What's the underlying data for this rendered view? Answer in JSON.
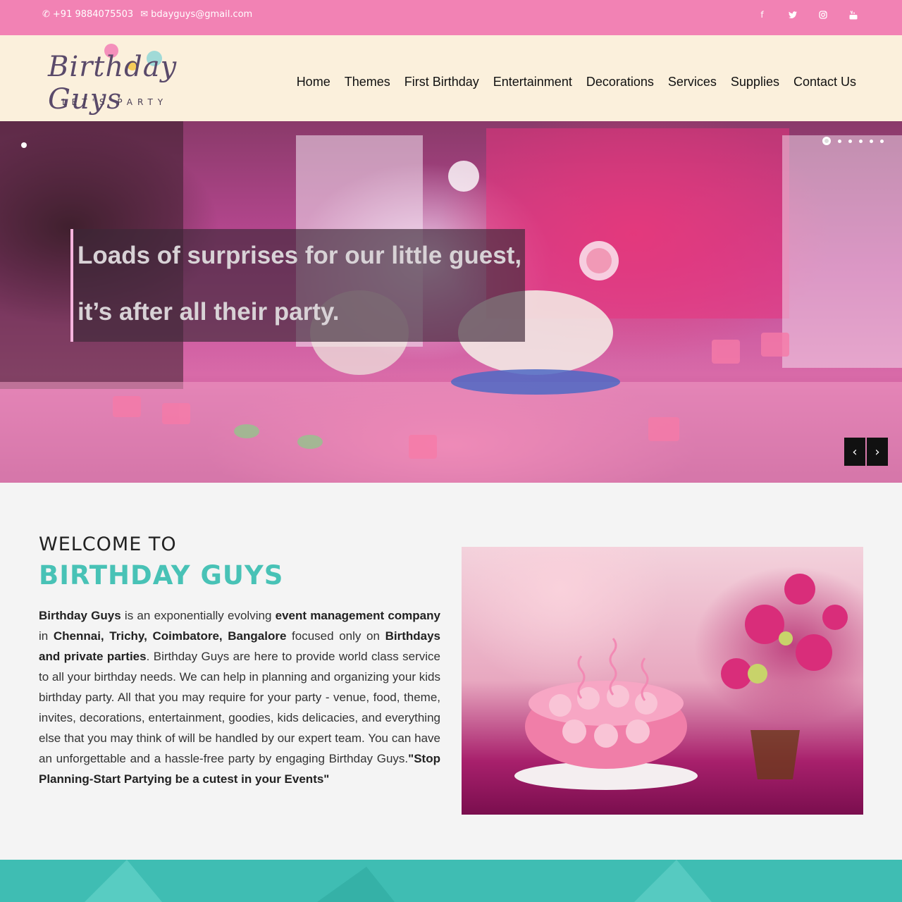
{
  "topbar": {
    "phone": "+91 9884075503",
    "email": "bdayguys@gmail.com",
    "social": [
      "facebook-icon",
      "twitter-icon",
      "instagram-icon",
      "youtube-icon"
    ]
  },
  "logo": {
    "name": "Birthday Guys",
    "tagline": "LET'S PARTY"
  },
  "nav": [
    "Home",
    "Themes",
    "First Birthday",
    "Entertainment",
    "Decorations",
    "Services",
    "Supplies",
    "Contact Us"
  ],
  "hero": {
    "caption_line1": "Loads of surprises for our little guest,",
    "caption_line2": "it’s after all their party.",
    "slides": 6,
    "active_slide": 1,
    "prev_icon": "chevron-left-icon",
    "next_icon": "chevron-right-icon"
  },
  "welcome": {
    "title_small": "WELCOME TO",
    "title_big": "BIRTHDAY GUYS",
    "p1_b1": "Birthday Guys",
    "p1_t1": " is an exponentially evolving ",
    "p1_b2": "event management company",
    "p1_t2": " in ",
    "p1_b3": "Chennai, Trichy, Coimbatore, Bangalore",
    "p1_t3": " focused only on ",
    "p1_b4": "Birthdays and private parties",
    "p1_t4": ". Birthday Guys are here to provide world class service to all your birthday needs. We can help in planning and organizing your kids birthday party. All that you may require for your party - venue, food, theme, invites, decorations, entertainment, goodies, kids delicacies, and everything else that you may think of will be handled by our expert team. You can have an unforgettable and a hassle-free party by engaging Birthday Guys.",
    "p1_b5": "\"Stop Planning-Start Partying be a cutest in your Events\""
  },
  "colors": {
    "topbar": "#f282b4",
    "header": "#fbf0dc",
    "accent_teal": "#48c2b6",
    "caption_border": "#f6b4de"
  }
}
